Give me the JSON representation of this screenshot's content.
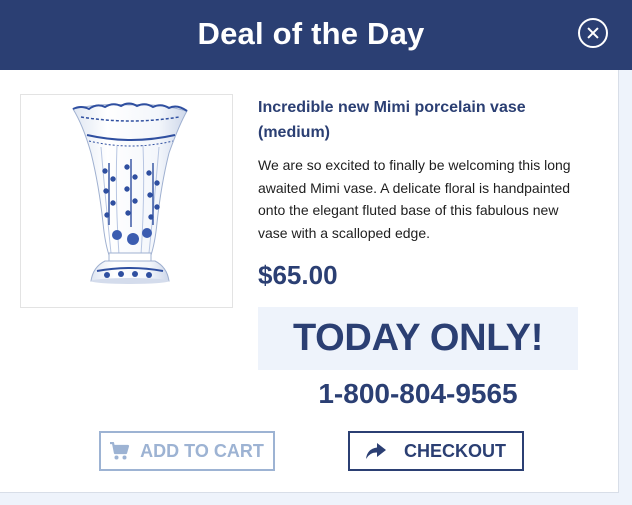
{
  "modal": {
    "title": "Deal of the Day",
    "close_icon": "close-circle-icon"
  },
  "product": {
    "image_alt": "Blue and white porcelain fluted vase",
    "name": "Incredible new Mimi porcelain vase (medium)",
    "description": "We are so excited to finally be welcoming this long awaited Mimi vase. A delicate floral is handpainted onto the elegant fluted base of this fabulous new vase with a scalloped edge.",
    "price": "$65.00"
  },
  "promo": {
    "banner": "TODAY ONLY!",
    "phone": "1-800-804-9565"
  },
  "actions": {
    "add_to_cart_label": "ADD TO CART",
    "add_to_cart_icon": "shopping-cart-icon",
    "checkout_label": "CHECKOUT",
    "checkout_icon": "share-arrow-icon"
  },
  "colors": {
    "brand_navy": "#2b3f73",
    "muted_blue": "#9db3d3",
    "banner_bg": "#eef3fb"
  }
}
